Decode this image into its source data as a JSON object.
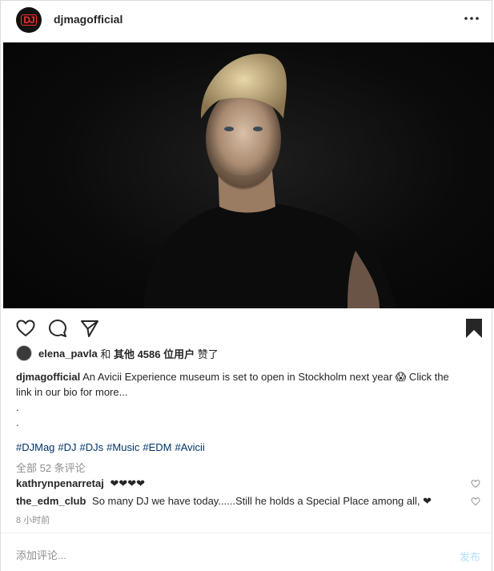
{
  "header": {
    "avatar_text": "DJ",
    "username": "djmagofficial"
  },
  "photo": {
    "alt": "Portrait of a man in a black t-shirt against a dark background"
  },
  "likes": {
    "user": "elena_pavla",
    "mid": " 和 ",
    "others": "其他 4586 位用户",
    "tail": " 赞了"
  },
  "caption": {
    "username": "djmagofficial",
    "text": "An Avicii Experience museum is set to open in Stockholm next year 😱 Click the",
    "text2": "link in our bio for more...",
    "dot1": ".",
    "dot2": "."
  },
  "hashtags": [
    "#DJMag",
    "#DJ",
    "#DJs",
    "#Music",
    "#EDM",
    "#Avicii"
  ],
  "all_comments": "全部 52 条评论",
  "comments": [
    {
      "user": "kathrynpenarretaj",
      "text": "❤❤❤❤"
    },
    {
      "user": "the_edm_club",
      "text": "So many DJ we have today......Still he holds a Special Place among all, ❤"
    }
  ],
  "time_ago": "8 小时前",
  "add_comment": {
    "placeholder": "添加评论...",
    "post_label": "发布"
  },
  "colors": {
    "link": "#003569",
    "muted": "#8e8e8e",
    "post_disabled": "#b2dffc",
    "avatar_brand": "#ff2d2d"
  }
}
